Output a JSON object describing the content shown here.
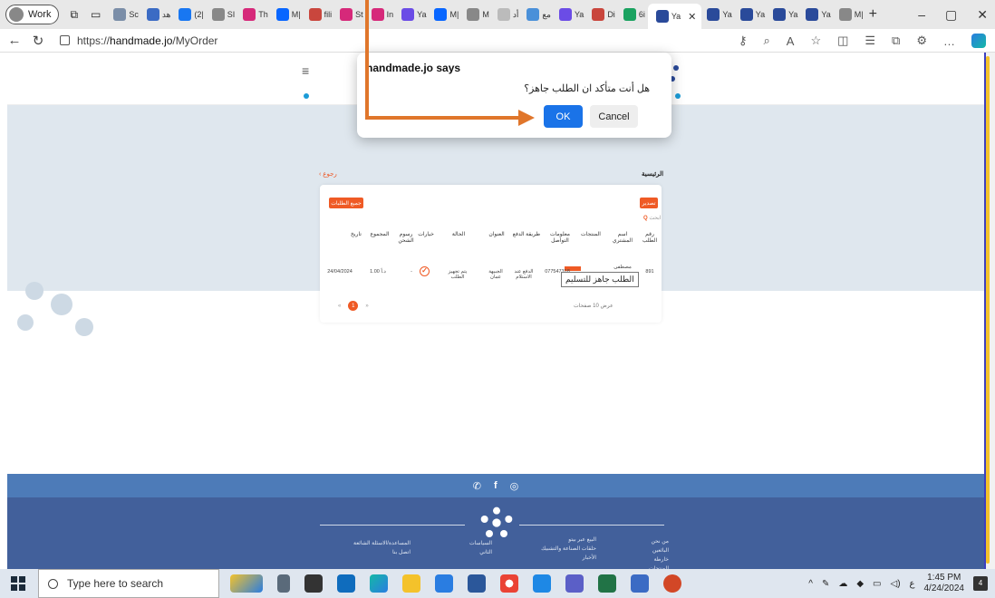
{
  "browser": {
    "profile_label": "Work",
    "tabs": [
      "Sc",
      "هد",
      "(2|",
      "SI",
      "Th",
      "M|",
      "fili",
      "St",
      "In",
      "Ya",
      "M|",
      "M",
      "أد",
      "مع",
      "Ya",
      "Di",
      "6i",
      "ha",
      "Ya",
      "Ya",
      "Ya",
      "Ya",
      "Ya",
      "M|"
    ],
    "active_tab": "Ya",
    "new_tab_label": "+",
    "url_prefix": "https://",
    "url_domain": "handmade.jo",
    "url_path": "/MyOrder"
  },
  "site": {
    "breadcrumb": "الرئيسية",
    "back_link": "رجوع",
    "export_button": "تصدير",
    "all_orders_button": "جميع الطلبات",
    "search_label": "ابحث",
    "table": {
      "columns": [
        "رقم الطلب",
        "اسم المشتري",
        "المنتجات",
        "معلومات التواصل",
        "طريقة الدفع",
        "العنوان",
        "الحالة",
        "خيارات",
        "رسوم الشحن",
        "المجموع",
        "تاريخ"
      ],
      "row": {
        "order_no": "891",
        "buyer": "مصطفى",
        "phone": "077547318",
        "payment": "الدفع عند الاستلام",
        "address": "الجبيهة عمان",
        "status": "يتم تجهيز الطلب",
        "shipping": "-",
        "total": "1.00 د.أ",
        "date": "24/04/2024"
      }
    },
    "tooltip": "الطلب جاهز للتسليم",
    "pager": {
      "prev": "«",
      "current": "1",
      "next": "»"
    },
    "per_page": "عرض 10 صفحات"
  },
  "footer": {
    "social": [
      "whatsapp-icon",
      "facebook-icon",
      "instagram-icon"
    ],
    "col1": [
      "من نحن",
      "البائعين",
      "خارطة المنتجات"
    ],
    "col2": [
      "البيع عبر بيتو",
      "حلقات الصناعة والتشبيك",
      "الأخبار"
    ],
    "col3": [
      "السياسات",
      "الثاني"
    ],
    "col4": [
      "المساعدة/الاسئلة الشائعة",
      "اتصل بنا"
    ]
  },
  "dialog": {
    "title": "handmade.jo says",
    "message": "هل أنت متأكد ان الطلب جاهز؟",
    "ok": "OK",
    "cancel": "Cancel"
  },
  "taskbar": {
    "search_placeholder": "Type here to search",
    "time": "1:45 PM",
    "date": "4/24/2024",
    "lang": "ع",
    "notifications": "4"
  },
  "colors": {
    "accent": "#ef5a25",
    "dialog_ok": "#1a73e8",
    "footer": "#42609b",
    "annotation_arrow": "#e0762b"
  }
}
